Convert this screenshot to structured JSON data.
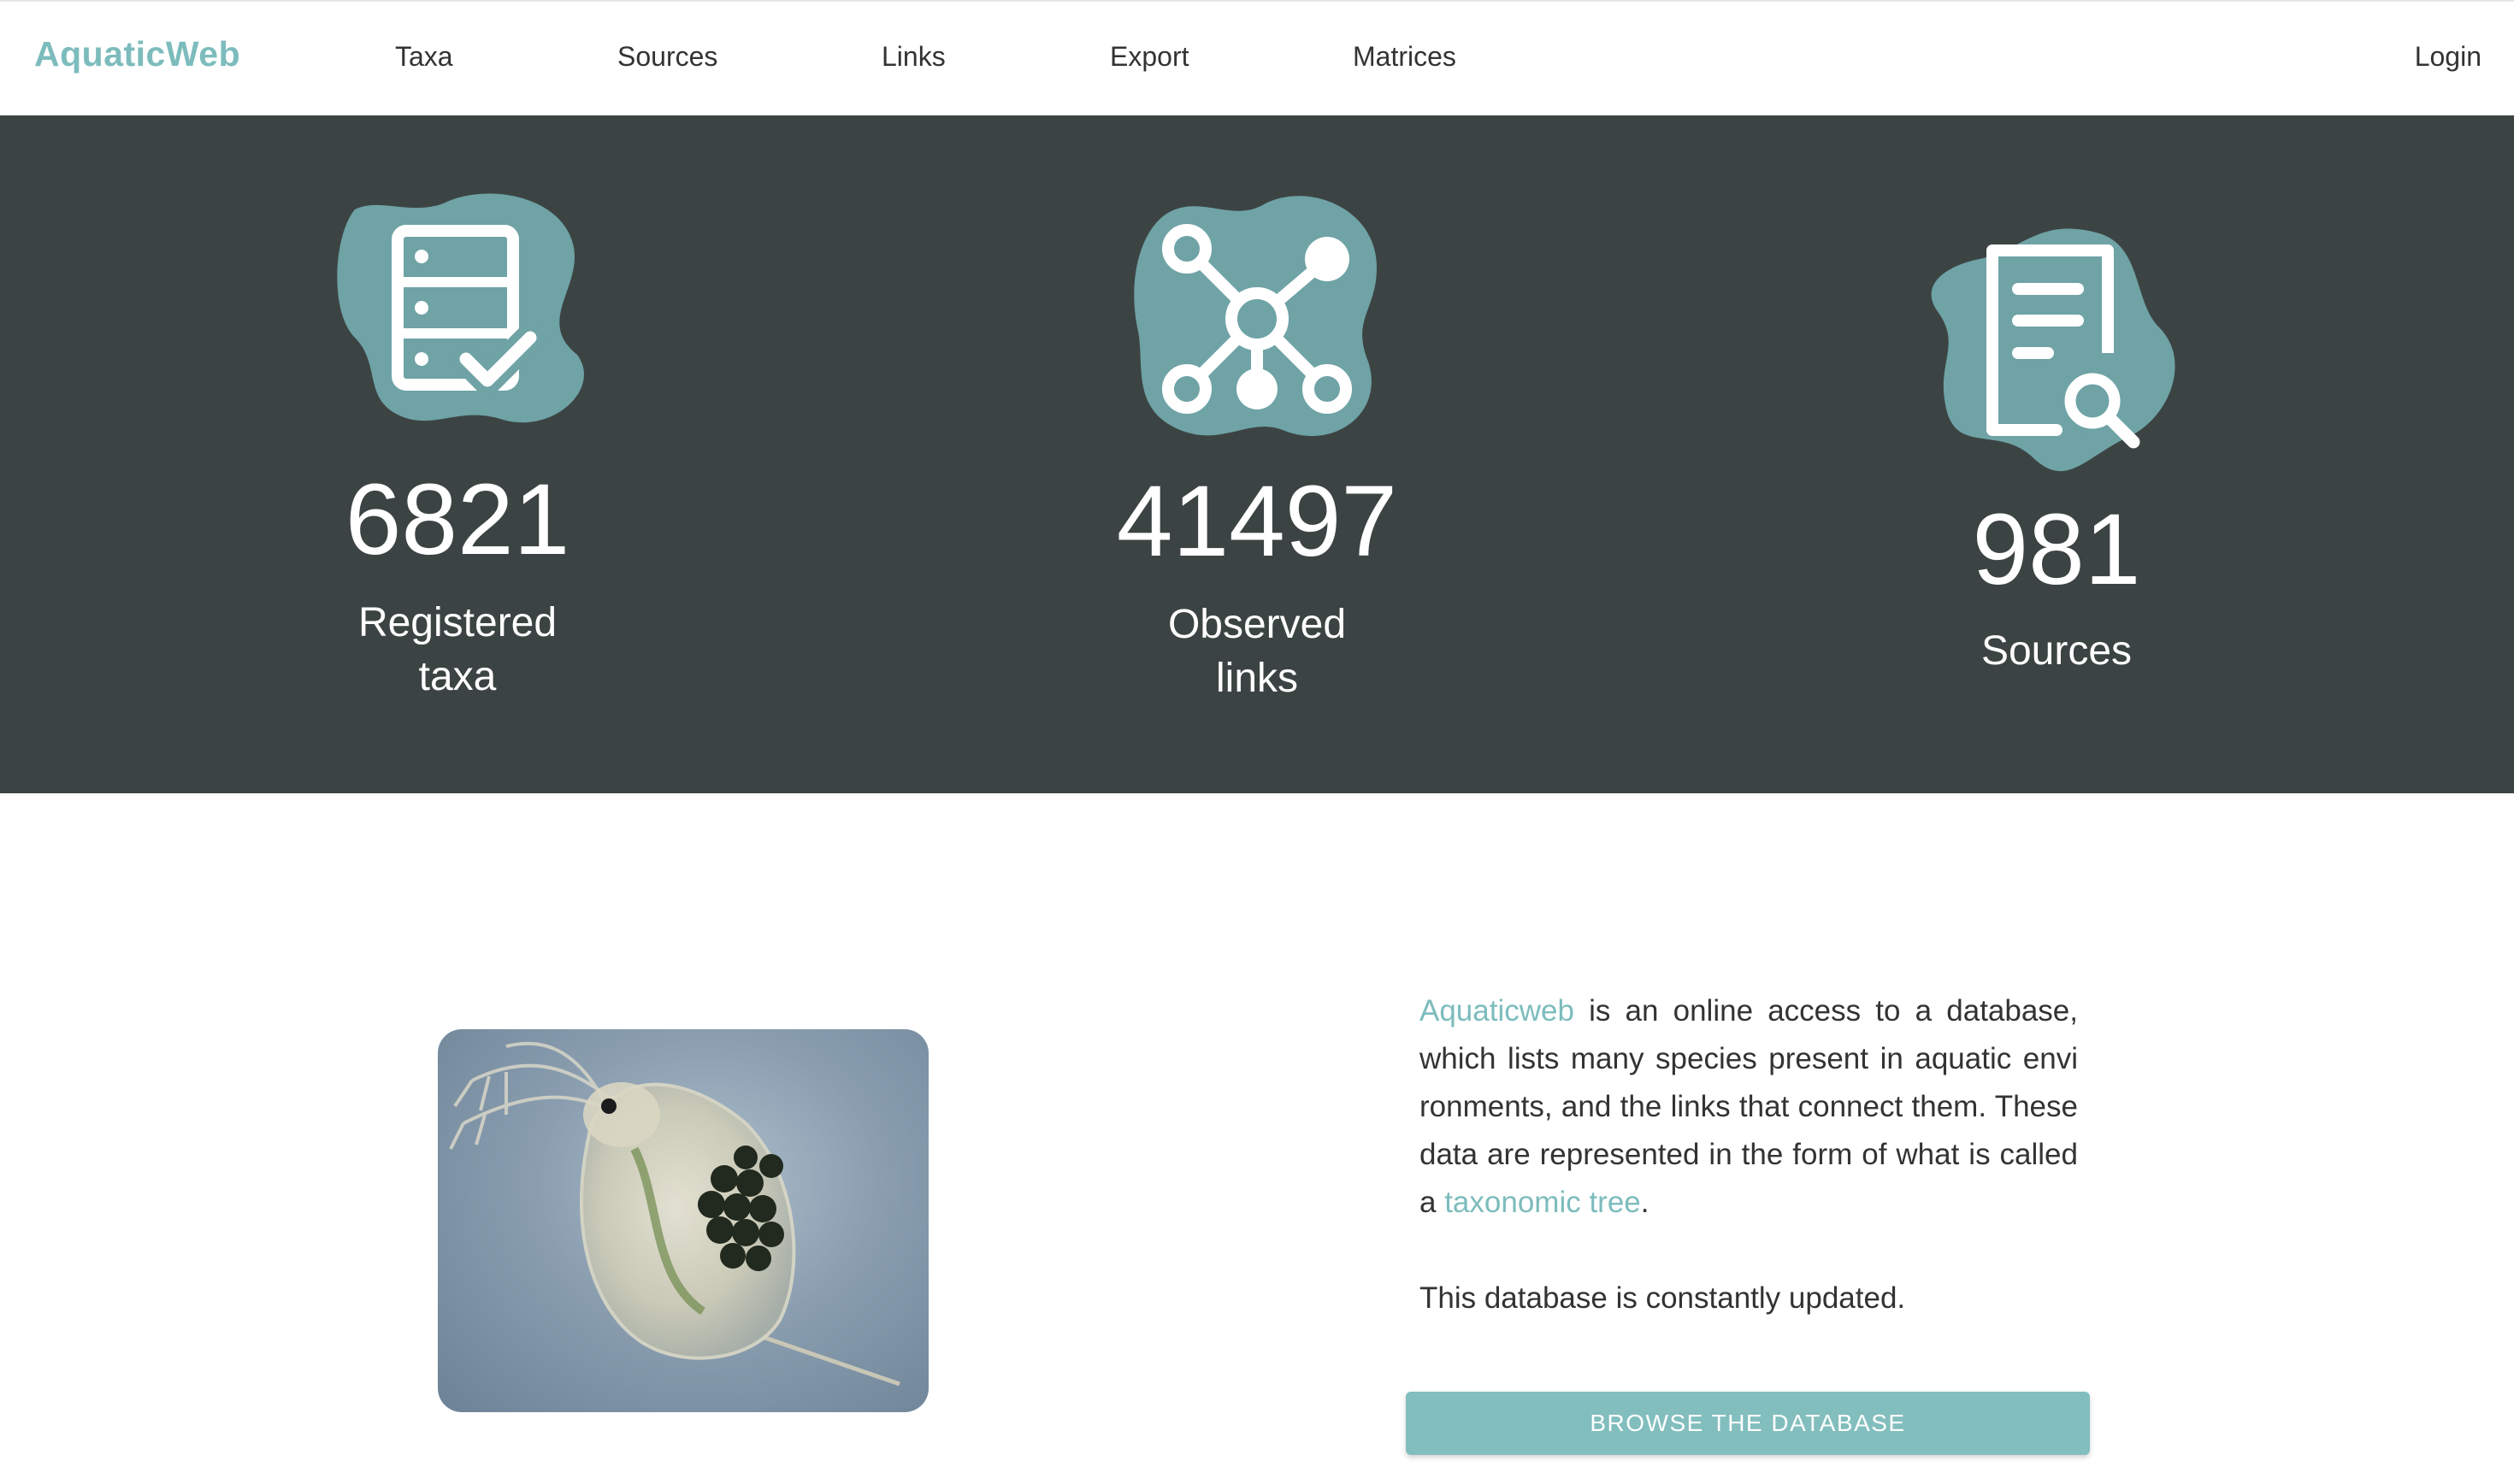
{
  "navbar": {
    "brand": "AquaticWeb",
    "items": [
      {
        "label": "Taxa"
      },
      {
        "label": "Sources"
      },
      {
        "label": "Links"
      },
      {
        "label": "Export"
      },
      {
        "label": "Matrices"
      }
    ],
    "login_label": "Login"
  },
  "stats": [
    {
      "icon": "database-check-icon",
      "value": "6821",
      "label_line1": "Registered",
      "label_line2": "taxa"
    },
    {
      "icon": "network-graph-icon",
      "value": "41497",
      "label_line1": "Observed",
      "label_line2": "links"
    },
    {
      "icon": "document-search-icon",
      "value": "981",
      "label_line1": "Sources",
      "label_line2": ""
    }
  ],
  "intro": {
    "image_subject": "daphnia-photo",
    "brand_link": "Aquaticweb",
    "text_part1": " is an online access to a database, which lists many species present in aquatic envi ronments, and the links that connect them. These data are represented in the form of what is called a ",
    "tree_link": "taxonomic tree",
    "text_part2": ".",
    "update_note": "This database is constantly updated.",
    "browse_button": "BROWSE THE DATABASE"
  },
  "colors": {
    "accent": "#7dbcbd",
    "band_background": "#3c4443",
    "icon_blob": "#6fa3a6",
    "button": "#82bebd"
  }
}
